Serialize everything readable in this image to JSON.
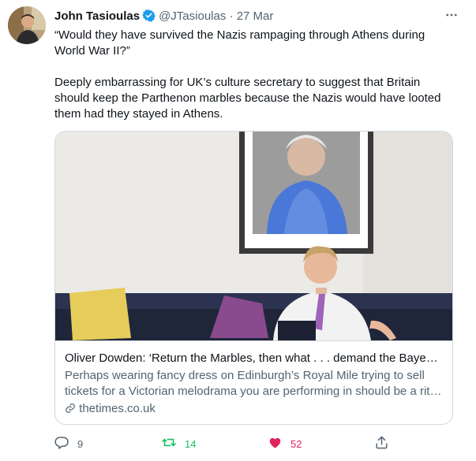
{
  "tweet": {
    "author_name": "John Tasioulas",
    "handle": "@JTasioulas",
    "separator": "·",
    "date": "27 Mar",
    "paragraph1": "“Would they have survived the Nazis rampaging through Athens during World War II?”",
    "paragraph2": "Deeply embarrassing for UK’s culture secretary to suggest that Britain should keep the Parthenon marbles because the Nazis would have looted them had they stayed in Athens."
  },
  "card": {
    "title": "Oliver Dowden: ‘Return the Marbles, then what . . . demand the Bayeux…",
    "description_line1": "Perhaps wearing fancy dress on Edinburgh’s Royal Mile trying to sell",
    "description_line2": "tickets for a Victorian melodrama you are performing in should be a rit…",
    "domain": "thetimes.co.uk"
  },
  "actions": {
    "reply_count": "9",
    "retweet_count": "14",
    "like_count": "52"
  },
  "icons": [
    "verified-icon",
    "more-icon",
    "link-icon",
    "reply-icon",
    "retweet-icon",
    "like-icon",
    "share-icon"
  ],
  "colors": {
    "accent": "#1d9bf0",
    "retweet": "#17bf63",
    "like": "#e0245e",
    "secondary_text": "#536471"
  }
}
